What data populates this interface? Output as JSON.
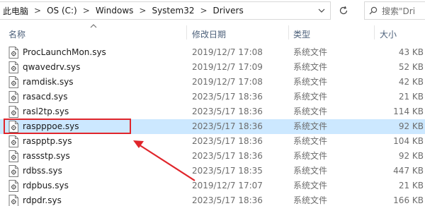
{
  "address": {
    "crumbs": [
      "此电脑",
      "OS (C:)",
      "Windows",
      "System32",
      "Drivers"
    ],
    "separator": ">",
    "search_placeholder": "搜索\"Dri"
  },
  "columns": {
    "name": "名称",
    "date": "修改日期",
    "type": "类型",
    "size": "大小"
  },
  "files": [
    {
      "name": "ProcLaunchMon.sys",
      "date": "2019/12/7 17:08",
      "type": "系统文件",
      "size": "43 KB",
      "selected": false
    },
    {
      "name": "qwavedrv.sys",
      "date": "2019/12/7 17:09",
      "type": "系统文件",
      "size": "52 KB",
      "selected": false
    },
    {
      "name": "ramdisk.sys",
      "date": "2019/12/7 17:08",
      "type": "系统文件",
      "size": "42 KB",
      "selected": false
    },
    {
      "name": "rasacd.sys",
      "date": "2023/5/17 18:36",
      "type": "系统文件",
      "size": "21 KB",
      "selected": false
    },
    {
      "name": "rasl2tp.sys",
      "date": "2023/5/17 18:36",
      "type": "系统文件",
      "size": "114 KB",
      "selected": false
    },
    {
      "name": "raspppoe.sys",
      "date": "2023/5/17 18:36",
      "type": "系统文件",
      "size": "92 KB",
      "selected": true
    },
    {
      "name": "raspptp.sys",
      "date": "2023/5/17 18:36",
      "type": "系统文件",
      "size": "104 KB",
      "selected": false
    },
    {
      "name": "rassstp.sys",
      "date": "2023/5/17 18:36",
      "type": "系统文件",
      "size": "92 KB",
      "selected": false
    },
    {
      "name": "rdbss.sys",
      "date": "2023/5/17 18:35",
      "type": "系统文件",
      "size": "447 KB",
      "selected": false
    },
    {
      "name": "rdpbus.sys",
      "date": "2019/12/7 17:07",
      "type": "系统文件",
      "size": "21 KB",
      "selected": false
    },
    {
      "name": "rdpdr.sys",
      "date": "2023/5/17 18:36",
      "type": "系统文件",
      "size": "166 KB",
      "selected": false
    }
  ],
  "colors": {
    "selection": "#cce8ff",
    "annotation": "#e0252b",
    "header_text": "#4c607a"
  },
  "icons": {
    "file": "sys-file-gear-icon",
    "refresh": "refresh-icon",
    "search": "search-icon",
    "dropdown": "chevron-down-icon",
    "sort": "sort-up-icon"
  }
}
